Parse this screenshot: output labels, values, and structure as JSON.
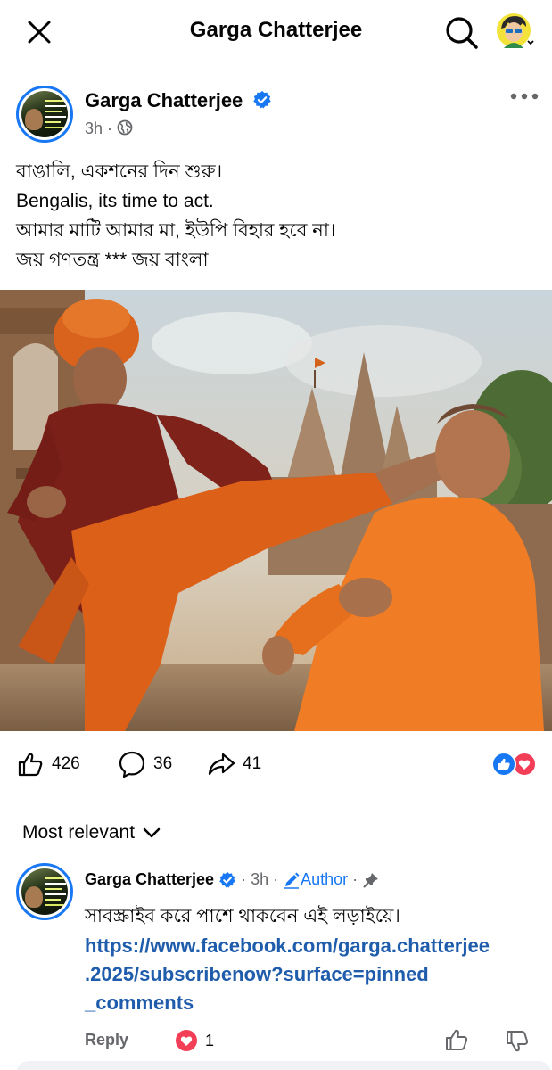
{
  "topbar": {
    "title": "Garga Chatterjee"
  },
  "post": {
    "author": "Garga Chatterjee",
    "time": "3h",
    "lines": [
      "বাঙালি, একশনের দিন শুরু।",
      "Bengalis, its time to act.",
      "আমার মাটি আমার মা, ইউপি বিহার হবে না।",
      "জয় গণতন্ত্র *** জয় বাংলা"
    ]
  },
  "actions": {
    "likes": "426",
    "comments": "36",
    "shares": "41"
  },
  "comments_section": {
    "sort_label": "Most relevant"
  },
  "comment": {
    "author": "Garga Chatterjee",
    "time": "3h",
    "badge": "Author",
    "text": "সাবস্ক্রাইব করে পাশে থাকবেন এই লড়াইয়ে।",
    "link_lines": [
      "https://www.facebook.com/garga.chatterjee",
      ".2025/subscribenow?surface=pinned",
      "_comments"
    ],
    "reply_label": "Reply",
    "reaction_count": "1"
  },
  "colors": {
    "brand_blue": "#1877f2",
    "link_blue": "#1f5cab",
    "meta_gray": "#65676b",
    "love_red": "#f33e58"
  }
}
